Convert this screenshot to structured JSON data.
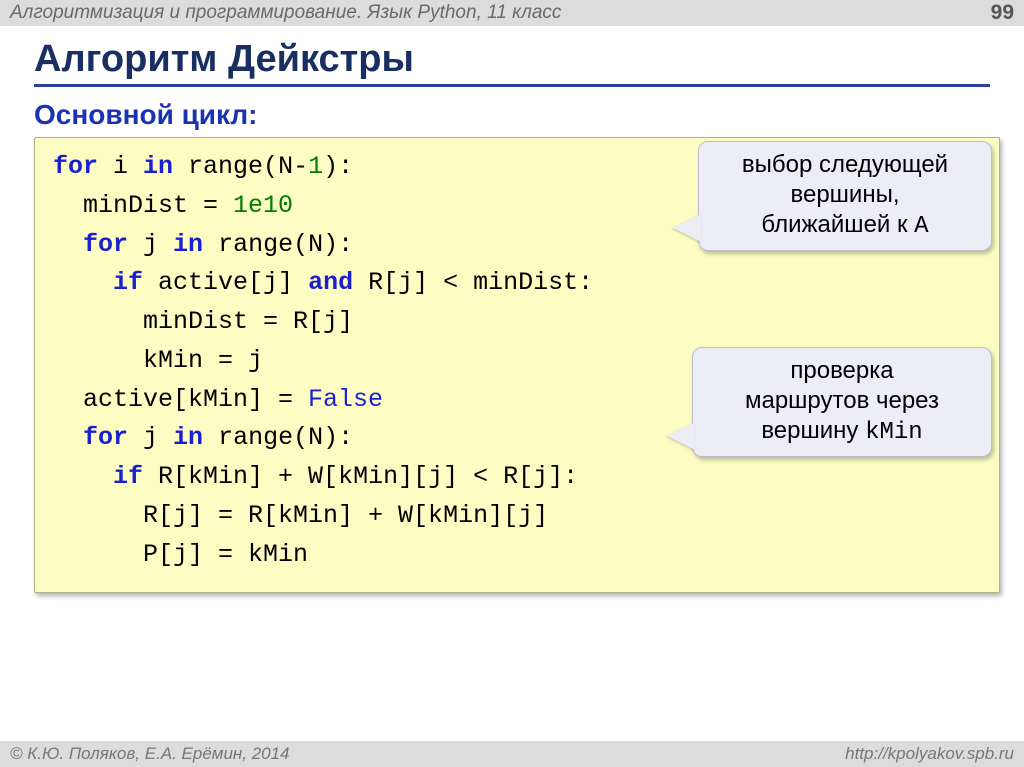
{
  "header": {
    "course": "Алгоритмизация и программирование. Язык Python, 11 класс",
    "page": "99"
  },
  "title": "Алгоритм Дейкстры",
  "subtitle": "Основной цикл:",
  "code": {
    "l1a": "for",
    "l1b": " i ",
    "l1c": "in",
    "l1d": " range(N-",
    "l1e": "1",
    "l1f": "):",
    "l2a": "  minDist = ",
    "l2b": "1e10",
    "l3a": "  ",
    "l3b": "for",
    "l3c": " j ",
    "l3d": "in",
    "l3e": " range(N):",
    "l4a": "    ",
    "l4b": "if",
    "l4c": " active[j] ",
    "l4d": "and",
    "l4e": " R[j] < minDist:",
    "l5": "      minDist = R[j]",
    "l6": "      kMin = j",
    "l7a": "  active[kMin] = ",
    "l7b": "False",
    "l8a": "  ",
    "l8b": "for",
    "l8c": " j ",
    "l8d": "in",
    "l8e": " range(N):",
    "l9a": "    ",
    "l9b": "if",
    "l9c": " R[kMin] + W[kMin][j] < R[j]:",
    "l10": "      R[j] = R[kMin] + W[kMin][j]",
    "l11": "      P[j] = kMin"
  },
  "callouts": {
    "c1_line1": "выбор следующей",
    "c1_line2": "вершины,",
    "c1_line3a": "ближайшей к ",
    "c1_line3b": "A",
    "c2_line1": "проверка",
    "c2_line2": "маршрутов через",
    "c2_line3a": "вершину ",
    "c2_line3b": "kMin"
  },
  "footer": {
    "left": "© К.Ю. Поляков, Е.А. Ерёмин, 2014",
    "right": "http://kpolyakov.spb.ru"
  }
}
